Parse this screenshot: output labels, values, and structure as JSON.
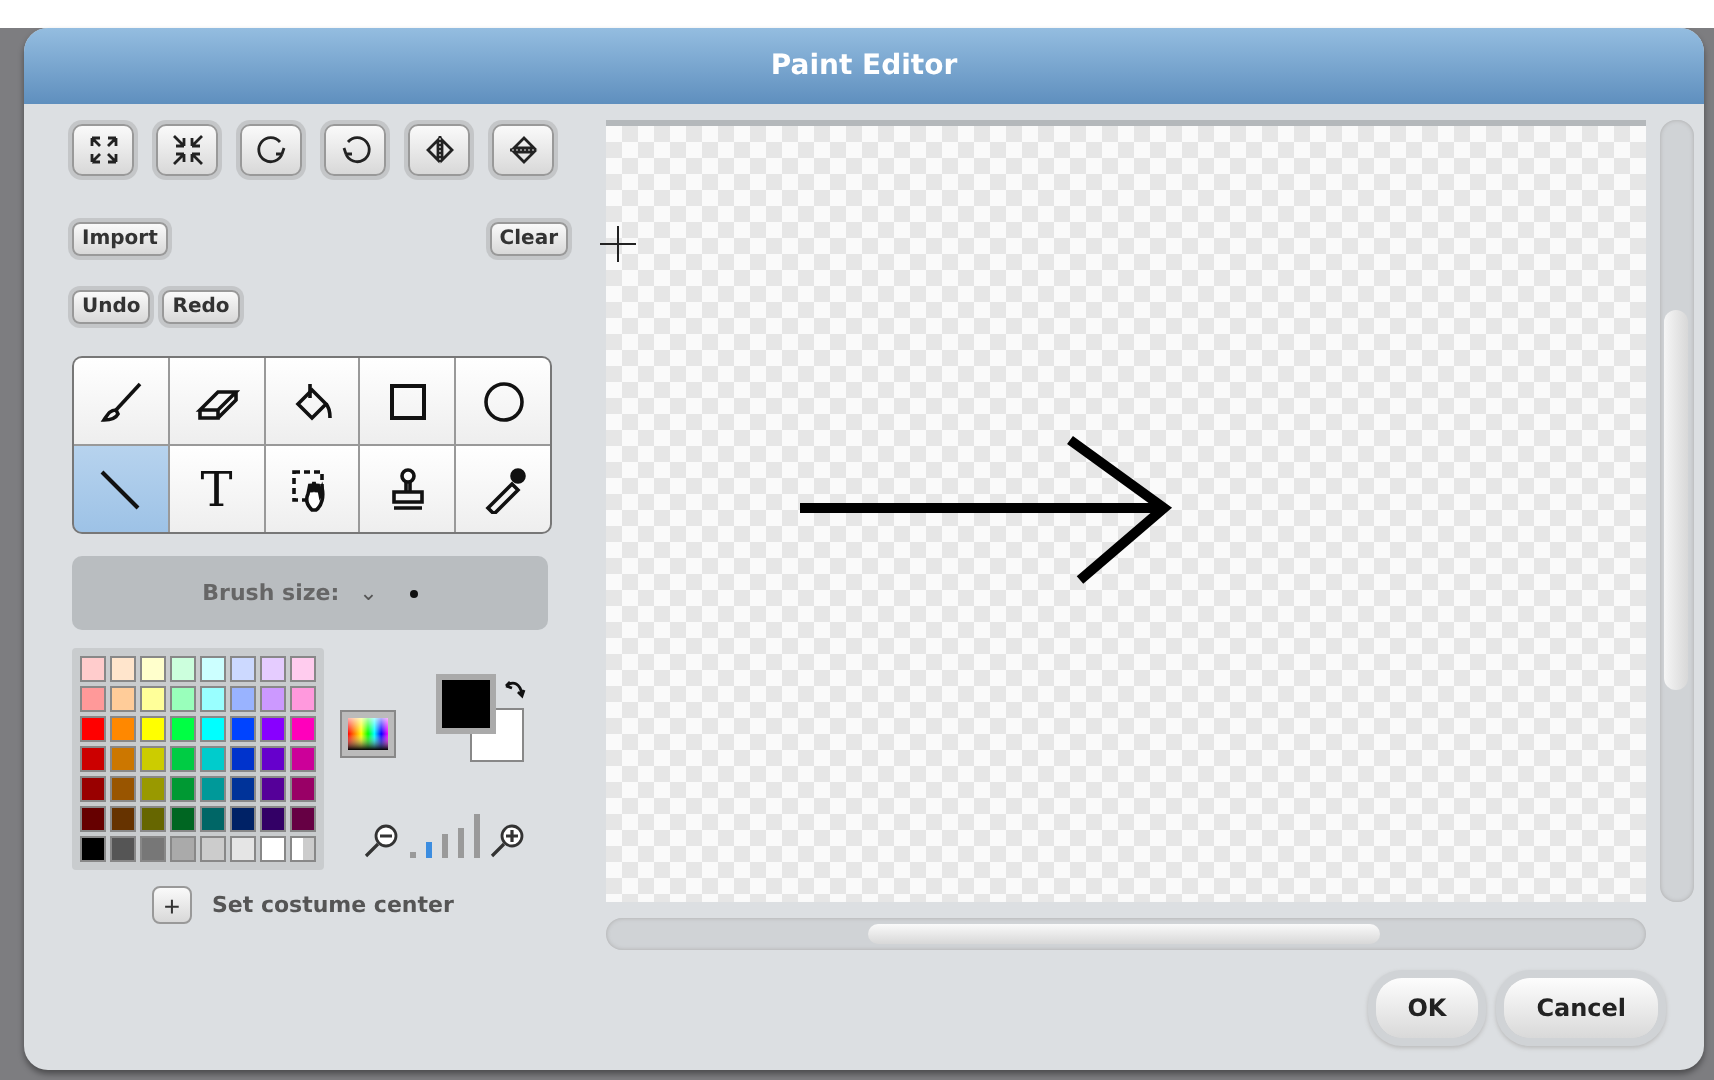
{
  "window": {
    "title": "Paint Editor"
  },
  "transform_buttons": [
    {
      "kind": "grow"
    },
    {
      "kind": "shrink"
    },
    {
      "kind": "rotate-left"
    },
    {
      "kind": "rotate-right"
    },
    {
      "kind": "flip-horizontal"
    },
    {
      "kind": "flip-vertical"
    }
  ],
  "buttons": {
    "import": "Import",
    "clear": "Clear",
    "undo": "Undo",
    "redo": "Redo"
  },
  "tools": [
    {
      "kind": "brush",
      "selected": false
    },
    {
      "kind": "eraser",
      "selected": false
    },
    {
      "kind": "fill",
      "selected": false
    },
    {
      "kind": "rectangle",
      "selected": false
    },
    {
      "kind": "ellipse",
      "selected": false
    },
    {
      "kind": "line",
      "selected": true
    },
    {
      "kind": "text",
      "label": "T",
      "selected": false
    },
    {
      "kind": "select",
      "selected": false
    },
    {
      "kind": "stamp",
      "selected": false
    },
    {
      "kind": "eyedropper",
      "selected": false
    }
  ],
  "brush_size": {
    "label": "Brush size:",
    "caret": "⌄"
  },
  "palette": [
    {
      "kind": "swatch",
      "color": "#ffcccc"
    },
    {
      "kind": "swatch",
      "color": "#ffe5cc"
    },
    {
      "kind": "swatch",
      "color": "#ffffcc"
    },
    {
      "kind": "swatch",
      "color": "#ccffdd"
    },
    {
      "kind": "swatch",
      "color": "#ccffff"
    },
    {
      "kind": "swatch",
      "color": "#ccd9ff"
    },
    {
      "kind": "swatch",
      "color": "#e5ccff"
    },
    {
      "kind": "swatch",
      "color": "#ffccee"
    },
    {
      "kind": "swatch",
      "color": "#ff9999"
    },
    {
      "kind": "swatch",
      "color": "#ffcc99"
    },
    {
      "kind": "swatch",
      "color": "#ffff99"
    },
    {
      "kind": "swatch",
      "color": "#99ffbb"
    },
    {
      "kind": "swatch",
      "color": "#99ffff"
    },
    {
      "kind": "swatch",
      "color": "#99b3ff"
    },
    {
      "kind": "swatch",
      "color": "#cc99ff"
    },
    {
      "kind": "swatch",
      "color": "#ff99dd"
    },
    {
      "kind": "swatch",
      "color": "#ff0000"
    },
    {
      "kind": "swatch",
      "color": "#ff8800"
    },
    {
      "kind": "swatch",
      "color": "#ffff00"
    },
    {
      "kind": "swatch",
      "color": "#00ff44"
    },
    {
      "kind": "swatch",
      "color": "#00ffff"
    },
    {
      "kind": "swatch",
      "color": "#0044ff"
    },
    {
      "kind": "swatch",
      "color": "#8800ff"
    },
    {
      "kind": "swatch",
      "color": "#ff00bb"
    },
    {
      "kind": "swatch",
      "color": "#cc0000"
    },
    {
      "kind": "swatch",
      "color": "#cc7700"
    },
    {
      "kind": "swatch",
      "color": "#cccc00"
    },
    {
      "kind": "swatch",
      "color": "#00cc44"
    },
    {
      "kind": "swatch",
      "color": "#00cccc"
    },
    {
      "kind": "swatch",
      "color": "#0033cc"
    },
    {
      "kind": "swatch",
      "color": "#6600cc"
    },
    {
      "kind": "swatch",
      "color": "#cc0099"
    },
    {
      "kind": "swatch",
      "color": "#990000"
    },
    {
      "kind": "swatch",
      "color": "#995500"
    },
    {
      "kind": "swatch",
      "color": "#999900"
    },
    {
      "kind": "swatch",
      "color": "#009933"
    },
    {
      "kind": "swatch",
      "color": "#009999"
    },
    {
      "kind": "swatch",
      "color": "#003399"
    },
    {
      "kind": "swatch",
      "color": "#550099"
    },
    {
      "kind": "swatch",
      "color": "#990066"
    },
    {
      "kind": "swatch",
      "color": "#660000"
    },
    {
      "kind": "swatch",
      "color": "#663300"
    },
    {
      "kind": "swatch",
      "color": "#666600"
    },
    {
      "kind": "swatch",
      "color": "#006622"
    },
    {
      "kind": "swatch",
      "color": "#006666"
    },
    {
      "kind": "swatch",
      "color": "#002266"
    },
    {
      "kind": "swatch",
      "color": "#330066"
    },
    {
      "kind": "swatch",
      "color": "#660044"
    },
    {
      "kind": "swatch",
      "color": "#000000"
    },
    {
      "kind": "swatch",
      "color": "#555555"
    },
    {
      "kind": "swatch",
      "color": "#777777"
    },
    {
      "kind": "swatch",
      "color": "#aaaaaa"
    },
    {
      "kind": "swatch",
      "color": "#cccccc"
    },
    {
      "kind": "swatch",
      "color": "#e5e5e5"
    },
    {
      "kind": "swatch",
      "color": "#ffffff"
    },
    {
      "kind": "transparent"
    }
  ],
  "selected_colors": [
    {
      "kind": "primary",
      "color": "#000000"
    },
    {
      "kind": "secondary",
      "color": "#ffffff"
    }
  ],
  "zoom_steps": [
    {
      "selected": false
    },
    {
      "selected": true
    },
    {
      "selected": false
    },
    {
      "selected": false
    },
    {
      "selected": false
    }
  ],
  "costume_center": {
    "label": "Set costume center",
    "icon": "+"
  },
  "dialog_buttons": {
    "ok": "OK",
    "cancel": "Cancel"
  }
}
